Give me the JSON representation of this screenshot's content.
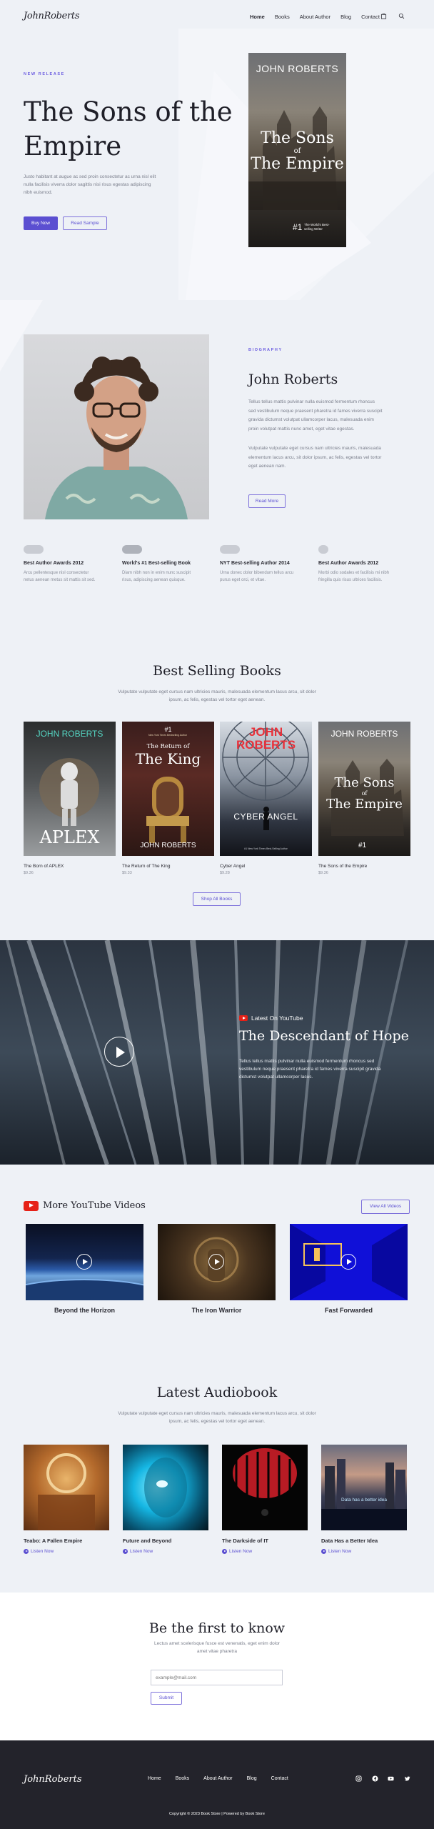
{
  "header": {
    "logo": "JohnRoberts",
    "nav": [
      "Home",
      "Books",
      "About Author",
      "Blog",
      "Contact"
    ]
  },
  "hero": {
    "tag": "NEW RELEASE",
    "title_line1": "The Sons of the",
    "title_line2": "Empire",
    "text_line1": "Justo habitant at augue ac sed proin consectetur ac urna nisl elit",
    "text_line2": "nulla facilisis viverra dolor sagittis nisi risus egestas adipiscing",
    "text_line3": "nibh euismod.",
    "buy_label": "Buy Now",
    "sample_label": "Read Sample",
    "cover": {
      "author": "JOHN ROBERTS",
      "title_line1": "The Sons",
      "title_of": "of",
      "title_line2": "The Empire",
      "badge": "#1",
      "badge_text": "The World's Best-selling Writer"
    }
  },
  "bio": {
    "tag": "BIOGRAPHY",
    "name": "John Roberts",
    "p1": [
      "Tellus tellus mattis pulvinar nulla euismod fermentum rhoncus",
      "sed vestibulum neque praesent pharetra id fames viverra suscipit",
      "gravida dictumst volutpat ullamcorper lacus, malesuada enim",
      "proin volutpat mattis nunc amet, eget vitae egestas."
    ],
    "p2": [
      "Vulputate vulputate eget cursus nam ultricies mauris, malesuada",
      "elementum lacus arcu, sit dolor ipsum, ac felis, egestas vel tortor",
      "eget aenean nam."
    ],
    "read_more": "Read More"
  },
  "awards": [
    {
      "title": "Best Author Awards 2012",
      "text": [
        "Arcu pellentesque nisl consectetur",
        "netus aenean metus sit mattis sit sed."
      ]
    },
    {
      "title": "World's #1 Best-selling Book",
      "text": [
        "Diam nibh non in enim nunc suscipit",
        "risus, adipiscing aenean quisque."
      ]
    },
    {
      "title": "NYT Best-selling Author 2014",
      "text": [
        "Urna donec dolor bibendum tellus arcu",
        "purus eget orci, et vitae."
      ]
    },
    {
      "title": "Best Author Awards 2012",
      "text": [
        "Morbi odio sodales et facilisis mi nibh",
        "fringilla quis risus ultrices facilisis."
      ]
    }
  ],
  "best_selling": {
    "title": "Best Selling Books",
    "sub_line1": "Vulputate vulputate eget cursus nam ultricies mauris, malesuada elementum lacus arcu, sit dolor",
    "sub_line2": "ipsum, ac felis, egestas vel tortor eget aenean.",
    "books": [
      {
        "name": "The Born of APLEX",
        "price": "$9.36",
        "cover_author": "JOHN ROBERTS",
        "cover_title": "APLEX"
      },
      {
        "name": "The Return of The King",
        "price": "$9.33",
        "cover_badge": "#1",
        "cover_badge_text": "New York Times Bestselling Author",
        "cover_small": "The Return of",
        "cover_title": "The King",
        "cover_author": "JOHN ROBERTS"
      },
      {
        "name": "Cyber Angel",
        "price": "$9.28",
        "cover_author_line1": "JOHN",
        "cover_author_line2": "ROBERTS",
        "cover_title": "CYBER ANGEL",
        "cover_tag": "#1 New York Times Best-Selling Author"
      },
      {
        "name": "The Sons of the Empire",
        "price": "$9.36",
        "cover_author": "JOHN ROBERTS",
        "cover_title_line1": "The Sons",
        "cover_title_of": "of",
        "cover_title_line2": "The Empire",
        "cover_badge": "#1"
      }
    ],
    "shop_all": "Shop All Books"
  },
  "feature_video": {
    "tag": "Latest On YouTube",
    "title": "The Descendant of Hope",
    "text": [
      "Tellus tellus mattis pulvinar nulla euismod fermentum rhoncus sed",
      "vestibulum neque praesent pharetra id fames viverra suscipit gravida",
      "dictumst volutpat ullamcorper lacus."
    ]
  },
  "youtube": {
    "title": "More YouTube Videos",
    "view_all": "View All Videos",
    "videos": [
      "Beyond the Horizon",
      "The Iron Warrior",
      "Fast Forwarded"
    ]
  },
  "audiobooks": {
    "title": "Latest Audiobook",
    "sub_line1": "Vulputate vulputate eget cursus nam ultricies mauris, malesuada elementum lacus arcu, sit dolor",
    "sub_line2": "ipsum, ac felis, egestas vel tortor eget aenean.",
    "listen": "Listen Now",
    "items": [
      "Teabo: A Fallen Empire",
      "Future and Beyond",
      "The Darkside of IT",
      "Data Has a Better Idea"
    ],
    "sign_text": "Data has a better idea"
  },
  "newsletter": {
    "title": "Be the first to know",
    "sub_line1": "Lectus amet scelerisque fusce est venenatis, eget enim dolor",
    "sub_line2": "amet vitae pharetra",
    "placeholder": "example@mail.com",
    "submit": "Submit"
  },
  "footer": {
    "logo": "JohnRoberts",
    "nav": [
      "Home",
      "Books",
      "About Author",
      "Blog",
      "Contact"
    ],
    "copyright": "Copyright © 2023 Book Store | Powered by Book Store"
  }
}
